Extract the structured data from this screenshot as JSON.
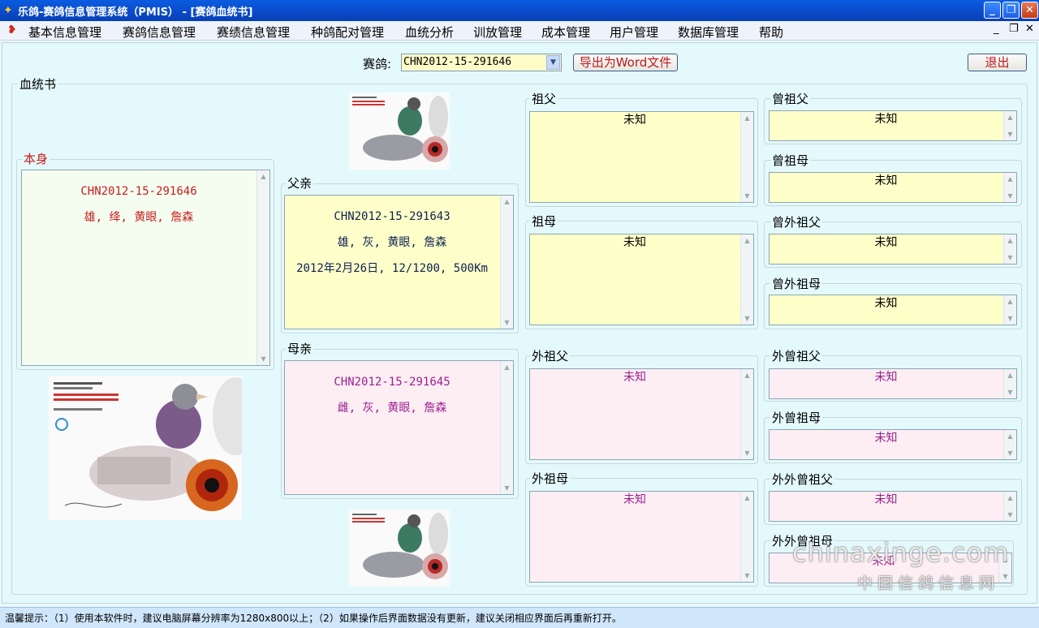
{
  "window": {
    "title": "乐鸽-赛鸽信息管理系统（PMIS） - [赛鸽血统书]"
  },
  "menu": {
    "items": [
      "基本信息管理",
      "赛鸽信息管理",
      "赛绩信息管理",
      "种鸽配对管理",
      "血统分析",
      "训放管理",
      "成本管理",
      "用户管理",
      "数据库管理",
      "帮助"
    ]
  },
  "toolbar": {
    "pigeon_label": "赛鸽:",
    "pigeon_value": "CHN2012-15-291646",
    "export_label": "导出为Word文件",
    "exit_label": "退出"
  },
  "pedigree": {
    "title": "血统书",
    "self": {
      "label": "本身",
      "line1": "CHN2012-15-291646",
      "line2": "雄, 绛, 黄眼, 詹森"
    },
    "father": {
      "label": "父亲",
      "line1": "CHN2012-15-291643",
      "line2": "雄, 灰, 黄眼, 詹森",
      "line3": "2012年2月26日, 12/1200, 500Km"
    },
    "mother": {
      "label": "母亲",
      "line1": "CHN2012-15-291645",
      "line2": "雌, 灰, 黄眼, 詹森"
    },
    "grandparents": [
      {
        "label": "祖父",
        "value": "未知"
      },
      {
        "label": "祖母",
        "value": "未知"
      },
      {
        "label": "外祖父",
        "value": "未知"
      },
      {
        "label": "外祖母",
        "value": "未知"
      }
    ],
    "great_grandparents": [
      {
        "label": "曾祖父",
        "value": "未知"
      },
      {
        "label": "曾祖母",
        "value": "未知"
      },
      {
        "label": "曾外祖父",
        "value": "未知"
      },
      {
        "label": "曾外祖母",
        "value": "未知"
      },
      {
        "label": "外曾祖父",
        "value": "未知"
      },
      {
        "label": "外曾祖母",
        "value": "未知"
      },
      {
        "label": "外外曾祖父",
        "value": "未知"
      },
      {
        "label": "外外曾祖母",
        "value": "未知"
      }
    ]
  },
  "status": {
    "tip": "温馨提示：（1）使用本软件时，建议电脑屏幕分辨率为1280x800以上；（2）如果操作后界面数据没有更新，建议关闭相应界面后再重新打开。"
  },
  "watermark": {
    "domain": "chinaxinge.com",
    "site": "中国信鸽信息网"
  },
  "colors": {
    "titlebar": "#0a4ac8",
    "client_bg": "#e4f9fb",
    "self_bg": "#f4fdf0",
    "paternal_bg": "#ffffc9",
    "maternal_bg": "#fdeef4",
    "accent_red": "#c81d1d",
    "maternal_text": "#9c1f8e"
  }
}
